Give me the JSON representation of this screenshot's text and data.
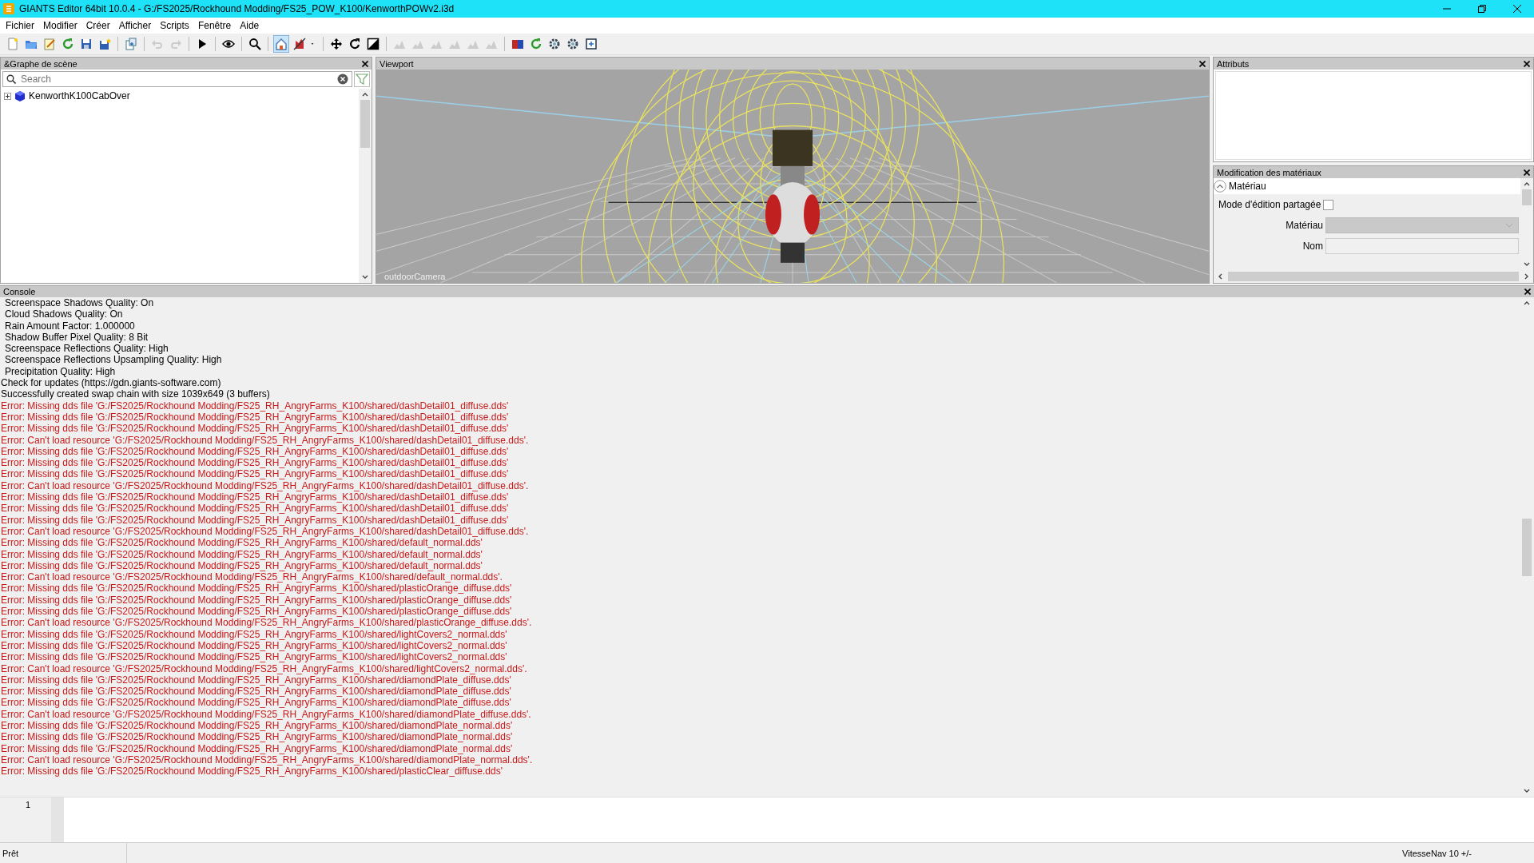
{
  "window": {
    "title": "GIANTS Editor 64bit 10.0.4 - G:/FS2025/Rockhound Modding/FS25_POW_K100/KenworthPOWv2.i3d"
  },
  "menu": [
    "Fichier",
    "Modifier",
    "Créer",
    "Afficher",
    "Scripts",
    "Fenêtre",
    "Aide"
  ],
  "toolbar": [
    {
      "buttons": [
        {
          "kind": "new",
          "disabled": false,
          "on": false
        },
        {
          "kind": "open",
          "disabled": false,
          "on": false
        },
        {
          "kind": "edit",
          "disabled": false,
          "on": false
        },
        {
          "kind": "reload",
          "disabled": false,
          "on": false
        },
        {
          "kind": "save",
          "disabled": false,
          "on": false
        },
        {
          "kind": "saveas",
          "disabled": false,
          "on": false
        }
      ]
    },
    {
      "buttons": [
        {
          "kind": "import",
          "disabled": false,
          "on": false
        }
      ]
    },
    {
      "buttons": [
        {
          "kind": "undo",
          "disabled": true,
          "on": false
        },
        {
          "kind": "redo",
          "disabled": true,
          "on": false
        }
      ]
    },
    {
      "buttons": [
        {
          "kind": "play",
          "disabled": false,
          "on": false
        }
      ]
    },
    {
      "buttons": [
        {
          "kind": "view",
          "disabled": false,
          "on": false
        }
      ]
    },
    {
      "buttons": [
        {
          "kind": "find",
          "disabled": false,
          "on": false
        }
      ]
    },
    {
      "buttons": [
        {
          "kind": "home",
          "disabled": false,
          "on": true
        },
        {
          "kind": "pick",
          "disabled": false,
          "on": false
        },
        {
          "kind": "dropdown",
          "disabled": false,
          "on": false
        }
      ]
    },
    {
      "buttons": [
        {
          "kind": "move",
          "disabled": false,
          "on": false
        },
        {
          "kind": "rotate",
          "disabled": false,
          "on": false
        },
        {
          "kind": "scale",
          "disabled": false,
          "on": false
        }
      ]
    },
    {
      "buttons": [
        {
          "kind": "terrain",
          "disabled": true,
          "on": false
        },
        {
          "kind": "terrain",
          "disabled": true,
          "on": false
        },
        {
          "kind": "terrain",
          "disabled": true,
          "on": false
        },
        {
          "kind": "terrain",
          "disabled": true,
          "on": false
        },
        {
          "kind": "terrain",
          "disabled": true,
          "on": false
        },
        {
          "kind": "terrain",
          "disabled": true,
          "on": false
        }
      ]
    },
    {
      "buttons": [
        {
          "kind": "material",
          "disabled": false,
          "on": false
        },
        {
          "kind": "refresh",
          "disabled": false,
          "on": false
        },
        {
          "kind": "gear",
          "disabled": false,
          "on": false
        },
        {
          "kind": "gear",
          "disabled": false,
          "on": false
        },
        {
          "kind": "export",
          "disabled": false,
          "on": false
        }
      ]
    }
  ],
  "scene_graph": {
    "title": "&Graphe de scène",
    "search": {
      "placeholder": "Search"
    },
    "items": [
      {
        "label": "KenworthK100CabOver",
        "expanded": false
      }
    ]
  },
  "viewport": {
    "title": "Viewport",
    "camera": "outdoorCamera"
  },
  "attributes": {
    "title": "Attributs"
  },
  "material_editor": {
    "title": "Modification des matériaux",
    "section": {
      "label": "Matériau",
      "expanded": true
    },
    "shared_edit": {
      "label": "Mode d'édition partagée",
      "checked": false
    },
    "material": {
      "label": "Matériau"
    },
    "name": {
      "label": "Nom"
    }
  },
  "console": {
    "title": "Console",
    "lines": [
      {
        "kind": "setting",
        "text": "Screenspace Shadows Quality: On"
      },
      {
        "kind": "setting",
        "text": "Cloud Shadows Quality: On"
      },
      {
        "kind": "setting",
        "text": "Rain Amount Factor: 1.000000"
      },
      {
        "kind": "setting",
        "text": "Shadow Buffer Pixel Quality: 8 Bit"
      },
      {
        "kind": "setting",
        "text": "Screenspace Reflections Quality: High"
      },
      {
        "kind": "setting",
        "text": "Screenspace Reflections Upsampling Quality: High"
      },
      {
        "kind": "setting",
        "text": "Precipitation Quality: High"
      },
      {
        "kind": "info",
        "text": "Check for updates (https://gdn.giants-software.com)"
      },
      {
        "kind": "info",
        "text": "Successfully created swap chain with size 1039x649 (3 buffers)"
      },
      {
        "kind": "error",
        "text": "Error: Missing dds file 'G:/FS2025/Rockhound Modding/FS25_RH_AngryFarms_K100/shared/dashDetail01_diffuse.dds'"
      },
      {
        "kind": "error",
        "text": "Error: Missing dds file 'G:/FS2025/Rockhound Modding/FS25_RH_AngryFarms_K100/shared/dashDetail01_diffuse.dds'"
      },
      {
        "kind": "error",
        "text": "Error: Missing dds file 'G:/FS2025/Rockhound Modding/FS25_RH_AngryFarms_K100/shared/dashDetail01_diffuse.dds'"
      },
      {
        "kind": "error",
        "text": "Error: Can't load resource 'G:/FS2025/Rockhound Modding/FS25_RH_AngryFarms_K100/shared/dashDetail01_diffuse.dds'."
      },
      {
        "kind": "error",
        "text": "Error: Missing dds file 'G:/FS2025/Rockhound Modding/FS25_RH_AngryFarms_K100/shared/dashDetail01_diffuse.dds'"
      },
      {
        "kind": "error",
        "text": "Error: Missing dds file 'G:/FS2025/Rockhound Modding/FS25_RH_AngryFarms_K100/shared/dashDetail01_diffuse.dds'"
      },
      {
        "kind": "error",
        "text": "Error: Missing dds file 'G:/FS2025/Rockhound Modding/FS25_RH_AngryFarms_K100/shared/dashDetail01_diffuse.dds'"
      },
      {
        "kind": "error",
        "text": "Error: Can't load resource 'G:/FS2025/Rockhound Modding/FS25_RH_AngryFarms_K100/shared/dashDetail01_diffuse.dds'."
      },
      {
        "kind": "error",
        "text": "Error: Missing dds file 'G:/FS2025/Rockhound Modding/FS25_RH_AngryFarms_K100/shared/dashDetail01_diffuse.dds'"
      },
      {
        "kind": "error",
        "text": "Error: Missing dds file 'G:/FS2025/Rockhound Modding/FS25_RH_AngryFarms_K100/shared/dashDetail01_diffuse.dds'"
      },
      {
        "kind": "error",
        "text": "Error: Missing dds file 'G:/FS2025/Rockhound Modding/FS25_RH_AngryFarms_K100/shared/dashDetail01_diffuse.dds'"
      },
      {
        "kind": "error",
        "text": "Error: Can't load resource 'G:/FS2025/Rockhound Modding/FS25_RH_AngryFarms_K100/shared/dashDetail01_diffuse.dds'."
      },
      {
        "kind": "error",
        "text": "Error: Missing dds file 'G:/FS2025/Rockhound Modding/FS25_RH_AngryFarms_K100/shared/default_normal.dds'"
      },
      {
        "kind": "error",
        "text": "Error: Missing dds file 'G:/FS2025/Rockhound Modding/FS25_RH_AngryFarms_K100/shared/default_normal.dds'"
      },
      {
        "kind": "error",
        "text": "Error: Missing dds file 'G:/FS2025/Rockhound Modding/FS25_RH_AngryFarms_K100/shared/default_normal.dds'"
      },
      {
        "kind": "error",
        "text": "Error: Can't load resource 'G:/FS2025/Rockhound Modding/FS25_RH_AngryFarms_K100/shared/default_normal.dds'."
      },
      {
        "kind": "error",
        "text": "Error: Missing dds file 'G:/FS2025/Rockhound Modding/FS25_RH_AngryFarms_K100/shared/plasticOrange_diffuse.dds'"
      },
      {
        "kind": "error",
        "text": "Error: Missing dds file 'G:/FS2025/Rockhound Modding/FS25_RH_AngryFarms_K100/shared/plasticOrange_diffuse.dds'"
      },
      {
        "kind": "error",
        "text": "Error: Missing dds file 'G:/FS2025/Rockhound Modding/FS25_RH_AngryFarms_K100/shared/plasticOrange_diffuse.dds'"
      },
      {
        "kind": "error",
        "text": "Error: Can't load resource 'G:/FS2025/Rockhound Modding/FS25_RH_AngryFarms_K100/shared/plasticOrange_diffuse.dds'."
      },
      {
        "kind": "error",
        "text": "Error: Missing dds file 'G:/FS2025/Rockhound Modding/FS25_RH_AngryFarms_K100/shared/lightCovers2_normal.dds'"
      },
      {
        "kind": "error",
        "text": "Error: Missing dds file 'G:/FS2025/Rockhound Modding/FS25_RH_AngryFarms_K100/shared/lightCovers2_normal.dds'"
      },
      {
        "kind": "error",
        "text": "Error: Missing dds file 'G:/FS2025/Rockhound Modding/FS25_RH_AngryFarms_K100/shared/lightCovers2_normal.dds'"
      },
      {
        "kind": "error",
        "text": "Error: Can't load resource 'G:/FS2025/Rockhound Modding/FS25_RH_AngryFarms_K100/shared/lightCovers2_normal.dds'."
      },
      {
        "kind": "error",
        "text": "Error: Missing dds file 'G:/FS2025/Rockhound Modding/FS25_RH_AngryFarms_K100/shared/diamondPlate_diffuse.dds'"
      },
      {
        "kind": "error",
        "text": "Error: Missing dds file 'G:/FS2025/Rockhound Modding/FS25_RH_AngryFarms_K100/shared/diamondPlate_diffuse.dds'"
      },
      {
        "kind": "error",
        "text": "Error: Missing dds file 'G:/FS2025/Rockhound Modding/FS25_RH_AngryFarms_K100/shared/diamondPlate_diffuse.dds'"
      },
      {
        "kind": "error",
        "text": "Error: Can't load resource 'G:/FS2025/Rockhound Modding/FS25_RH_AngryFarms_K100/shared/diamondPlate_diffuse.dds'."
      },
      {
        "kind": "error",
        "text": "Error: Missing dds file 'G:/FS2025/Rockhound Modding/FS25_RH_AngryFarms_K100/shared/diamondPlate_normal.dds'"
      },
      {
        "kind": "error",
        "text": "Error: Missing dds file 'G:/FS2025/Rockhound Modding/FS25_RH_AngryFarms_K100/shared/diamondPlate_normal.dds'"
      },
      {
        "kind": "error",
        "text": "Error: Missing dds file 'G:/FS2025/Rockhound Modding/FS25_RH_AngryFarms_K100/shared/diamondPlate_normal.dds'"
      },
      {
        "kind": "error",
        "text": "Error: Can't load resource 'G:/FS2025/Rockhound Modding/FS25_RH_AngryFarms_K100/shared/diamondPlate_normal.dds'."
      },
      {
        "kind": "error",
        "text": "Error: Missing dds file 'G:/FS2025/Rockhound Modding/FS25_RH_AngryFarms_K100/shared/plasticClear_diffuse.dds'"
      }
    ],
    "input": {
      "line_number": "1"
    }
  },
  "status_bar": {
    "message": "Prêt",
    "nav_speed": "VitesseNav 10 +/-"
  }
}
